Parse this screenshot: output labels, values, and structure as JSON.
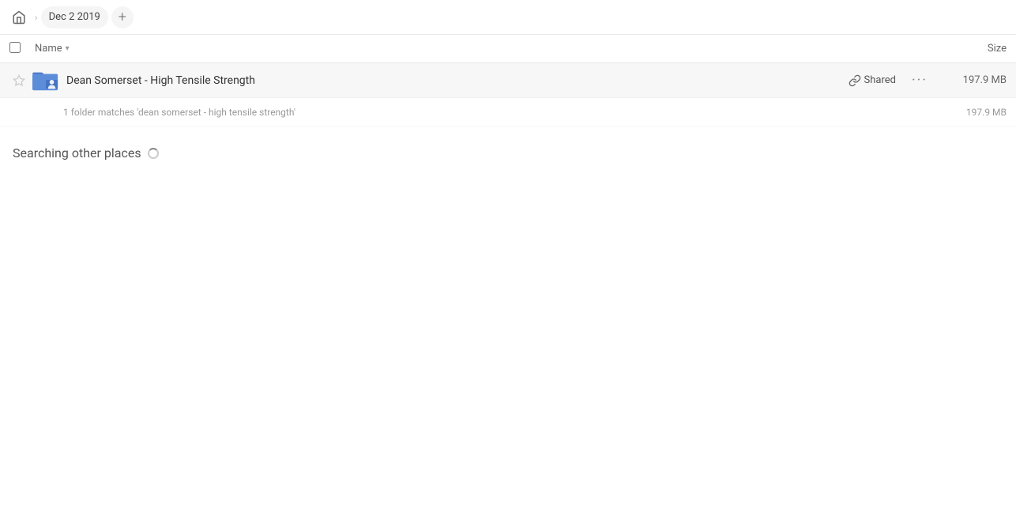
{
  "breadcrumb": {
    "home_label": "Home",
    "current_tab": "Dec 2 2019",
    "add_tab_label": "+"
  },
  "columns": {
    "name_label": "Name",
    "size_label": "Size"
  },
  "file_row": {
    "name": "Dean Somerset - High Tensile Strength",
    "shared_label": "Shared",
    "more_label": "...",
    "size": "197.9 MB"
  },
  "match_row": {
    "text": "1 folder matches 'dean somerset - high tensile strength'",
    "size": "197.9 MB"
  },
  "searching_section": {
    "title": "Searching other places"
  },
  "icons": {
    "home": "⌂",
    "star": "★",
    "link": "🔗",
    "folder_color": "#5b8dd9",
    "folder_tab_color": "#4a75c4"
  }
}
